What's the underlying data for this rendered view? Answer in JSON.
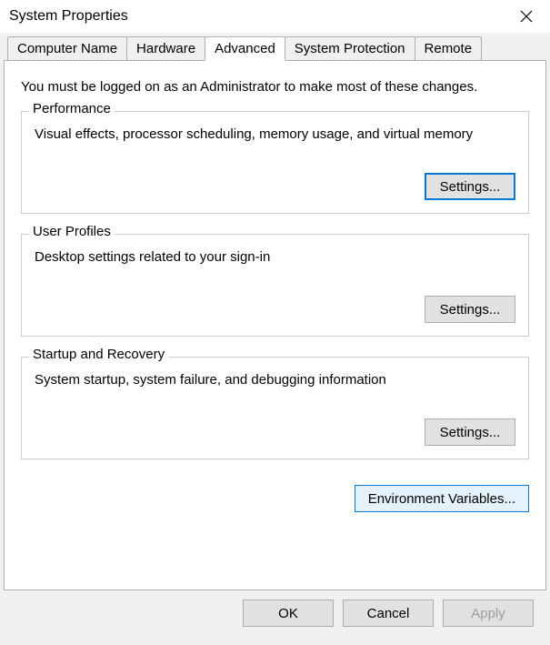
{
  "window": {
    "title": "System Properties"
  },
  "tabs": [
    {
      "label": "Computer Name"
    },
    {
      "label": "Hardware"
    },
    {
      "label": "Advanced"
    },
    {
      "label": "System Protection"
    },
    {
      "label": "Remote"
    }
  ],
  "active_tab_index": 2,
  "intro": "You must be logged on as an Administrator to make most of these changes.",
  "groups": {
    "performance": {
      "legend": "Performance",
      "desc": "Visual effects, processor scheduling, memory usage, and virtual memory",
      "button": "Settings..."
    },
    "user_profiles": {
      "legend": "User Profiles",
      "desc": "Desktop settings related to your sign-in",
      "button": "Settings..."
    },
    "startup_recovery": {
      "legend": "Startup and Recovery",
      "desc": "System startup, system failure, and debugging information",
      "button": "Settings..."
    }
  },
  "env_button": "Environment Variables...",
  "footer": {
    "ok": "OK",
    "cancel": "Cancel",
    "apply": "Apply"
  }
}
